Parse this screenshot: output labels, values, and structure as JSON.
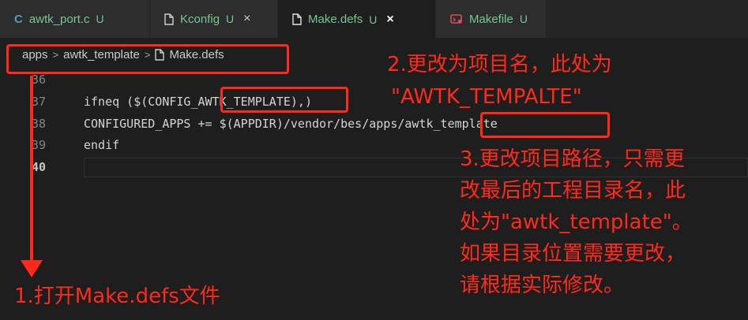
{
  "tabs": [
    {
      "icon": "c-file-icon",
      "glyph": "C",
      "label": "awtk_port.c",
      "status": "U",
      "close": ""
    },
    {
      "icon": "file-icon",
      "label": "Kconfig",
      "status": "U",
      "close": "×"
    },
    {
      "icon": "file-icon",
      "label": "Make.defs",
      "status": "U",
      "close": "×"
    },
    {
      "icon": "makefile-icon",
      "label": "Makefile",
      "status": "U",
      "close": ""
    }
  ],
  "breadcrumb": {
    "items": [
      "apps",
      "awtk_template",
      "Make.defs"
    ],
    "separator": ">"
  },
  "editor": {
    "lines": [
      {
        "number": "36",
        "text": ""
      },
      {
        "number": "37",
        "text": "ifneq ($(CONFIG_AWTK_TEMPLATE),)"
      },
      {
        "number": "38",
        "text": "CONFIGURED_APPS += $(APPDIR)/vendor/bes/apps/awtk_template"
      },
      {
        "number": "39",
        "text": "endif"
      },
      {
        "number": "40",
        "text": ""
      }
    ]
  },
  "annotations": {
    "note1": "1.打开Make.defs文件",
    "note2_line1": "2.更改为项目名，此处为",
    "note2_line2": "\"AWTK_TEMPALTE\"",
    "note3_lines": [
      "3.更改项目路径，只需更",
      "改最后的工程目录名，此",
      "处为\"awtk_template\"。",
      "如果目录位置需要更改，",
      "请根据实际修改。"
    ],
    "color": "#ff2a1a"
  },
  "colors": {
    "modified": "#73c991",
    "background": "#1e1e1e",
    "tabbar": "#252526"
  }
}
